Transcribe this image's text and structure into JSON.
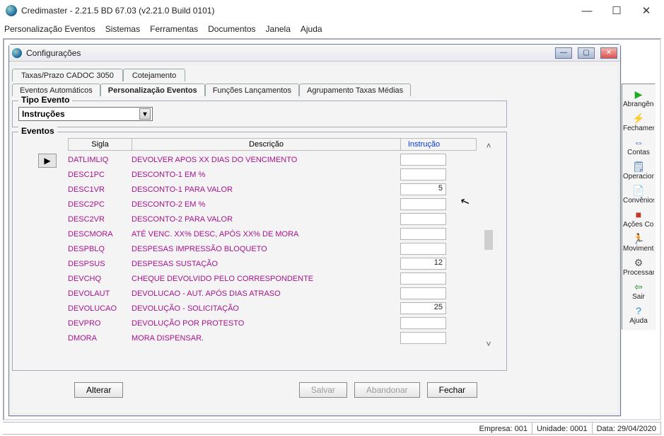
{
  "window": {
    "title": "Credimaster - 2.21.5 BD 67.03 (v2.21.0 Build 0101)"
  },
  "menu": [
    "Personalização Eventos",
    "Sistemas",
    "Ferramentas",
    "Documentos",
    "Janela",
    "Ajuda"
  ],
  "toolbar_right": [
    {
      "label": "Abrangência",
      "glyph": "▶",
      "color": "#22aa22"
    },
    {
      "label": "Fechamento",
      "glyph": "⚡",
      "color": "#d9a400"
    },
    {
      "label": "Contas",
      "glyph": "⇔",
      "color": "#3a6fb0"
    },
    {
      "label": "Operacional",
      "glyph": "🗒",
      "color": "#3a6fb0"
    },
    {
      "label": "Convênios",
      "glyph": "📄",
      "color": "#3a6fb0"
    },
    {
      "label": "Ações Cob.",
      "glyph": "■",
      "color": "#c0392b"
    },
    {
      "label": "Movimenta...",
      "glyph": "🏃",
      "color": "#222"
    },
    {
      "label": "Processam...",
      "glyph": "⚙",
      "color": "#555"
    },
    {
      "label": "Sair",
      "glyph": "⇦",
      "color": "#2d8a2d"
    },
    {
      "label": "Ajuda",
      "glyph": "?",
      "color": "#2887d6"
    }
  ],
  "child": {
    "title": "Configurações",
    "tabs_top": [
      "Taxas/Prazo CADOC 3050",
      "Cotejamento"
    ],
    "tabs_sub": [
      "Eventos Automáticos",
      "Personalização Eventos",
      "Funções Lançamentos",
      "Agrupamento Taxas Médias"
    ],
    "tabs_sub_active": 1,
    "tipo_evento": {
      "legend": "Tipo Evento",
      "selected": "Instruções"
    },
    "eventos": {
      "legend": "Eventos",
      "columns": {
        "sigla": "Sigla",
        "descricao": "Descrição",
        "instrucao": "Instrução"
      },
      "rows": [
        {
          "sigla": "DATLIMLIQ",
          "descricao": "DEVOLVER APOS XX DIAS DO VENCIMENTO",
          "instrucao": ""
        },
        {
          "sigla": "DESC1PC",
          "descricao": "DESCONTO-1 EM %",
          "instrucao": ""
        },
        {
          "sigla": "DESC1VR",
          "descricao": "DESCONTO-1 PARA VALOR",
          "instrucao": "5"
        },
        {
          "sigla": "DESC2PC",
          "descricao": "DESCONTO-2 EM %",
          "instrucao": ""
        },
        {
          "sigla": "DESC2VR",
          "descricao": "DESCONTO-2 PARA VALOR",
          "instrucao": ""
        },
        {
          "sigla": "DESCMORA",
          "descricao": "ATÉ VENC. XX%  DESC, APÓS XX% DE MORA",
          "instrucao": ""
        },
        {
          "sigla": "DESPBLQ",
          "descricao": "DESPESAS IMPRESSÃO BLOQUETO",
          "instrucao": ""
        },
        {
          "sigla": "DESPSUS",
          "descricao": "DESPESAS SUSTAÇÃO",
          "instrucao": "12"
        },
        {
          "sigla": "DEVCHQ",
          "descricao": "CHEQUE DEVOLVIDO PELO CORRESPONDENTE",
          "instrucao": ""
        },
        {
          "sigla": "DEVOLAUT",
          "descricao": "DEVOLUCAO -  AUT.  APÓS  DIAS ATRASO",
          "instrucao": ""
        },
        {
          "sigla": "DEVOLUCAO",
          "descricao": "DEVOLUÇÃO - SOLICITAÇÃO",
          "instrucao": "25"
        },
        {
          "sigla": "DEVPRO",
          "descricao": "DEVOLUÇÃO POR PROTESTO",
          "instrucao": ""
        },
        {
          "sigla": "DMORA",
          "descricao": "MORA DISPENSAR.",
          "instrucao": ""
        }
      ],
      "active_row": 1
    },
    "buttons": {
      "alterar": "Alterar",
      "salvar": "Salvar",
      "abandonar": "Abandonar",
      "fechar": "Fechar"
    }
  },
  "status": {
    "empresa_label": "Empresa:",
    "empresa_value": "001",
    "unidade_label": "Unidade:",
    "unidade_value": "0001",
    "data_label": "Data:",
    "data_value": "29/04/2020"
  }
}
